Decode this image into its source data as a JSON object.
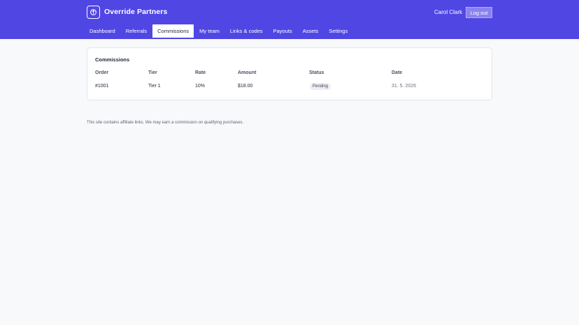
{
  "header": {
    "brand": "Override Partners",
    "logo_icon": "shield-icon",
    "user_name": "Carol Clark",
    "logout_label": "Log out",
    "accent": "#5046e4"
  },
  "nav": {
    "items": [
      {
        "label": "Dashboard"
      },
      {
        "label": "Referrals"
      },
      {
        "label": "Commissions",
        "active": true
      },
      {
        "label": "My team"
      },
      {
        "label": "Links & codes"
      },
      {
        "label": "Payouts"
      },
      {
        "label": "Assets"
      },
      {
        "label": "Settings"
      }
    ]
  },
  "commissions": {
    "title": "Commissions",
    "columns": [
      "Order",
      "Tier",
      "Rate",
      "Amount",
      "Status",
      "Date"
    ],
    "rows": [
      {
        "order": "#1001",
        "tier": "Tier 1",
        "rate": "10%",
        "amount": "$18.00",
        "status": "Pending",
        "date": "31. 5. 2026"
      }
    ]
  },
  "footer": {
    "note": "This site contains affiliate links. We may earn a commission on qualifying purchases."
  }
}
